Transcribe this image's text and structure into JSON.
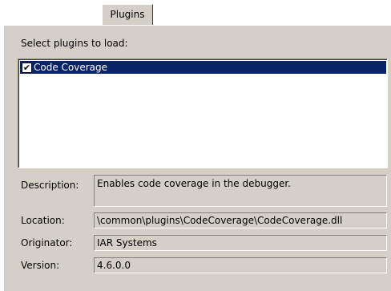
{
  "tab": {
    "label": "Plugins"
  },
  "plugins": {
    "heading": "Select plugins to load:",
    "items": [
      {
        "label": "Code Coverage",
        "checked": true,
        "selected": true
      }
    ]
  },
  "details": {
    "description_label": "Description:",
    "description_value": "Enables code coverage in the debugger.",
    "location_label": "Location:",
    "location_value": "\\common\\plugins\\CodeCoverage\\CodeCoverage.dll",
    "originator_label": "Originator:",
    "originator_value": "IAR Systems",
    "version_label": "Version:",
    "version_value": "4.6.0.0"
  },
  "colors": {
    "panel": "#d4d0c8",
    "selection": "#0a246a"
  },
  "icons": {
    "checkbox": "checkbox-checked-icon"
  }
}
